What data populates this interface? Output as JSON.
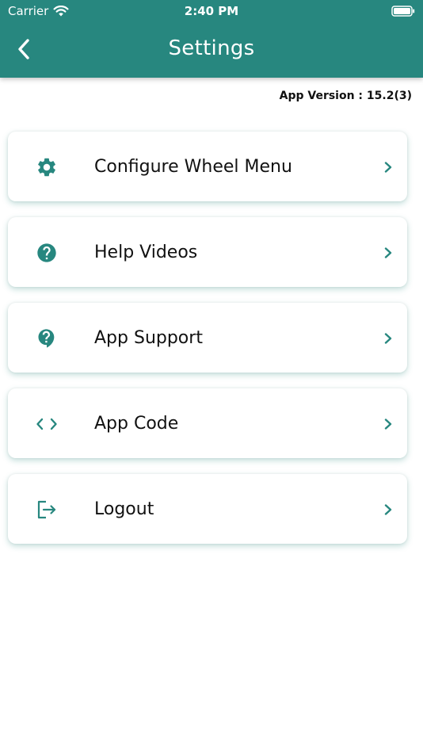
{
  "status_bar": {
    "carrier": "Carrier",
    "time": "2:40 PM"
  },
  "header": {
    "title": "Settings",
    "back_icon": "chevron-left-icon"
  },
  "app_version": "App Version : 15.2(3)",
  "menu": {
    "items": [
      {
        "label": "Configure Wheel Menu",
        "icon": "gear-icon"
      },
      {
        "label": "Help Videos",
        "icon": "help-circle-icon"
      },
      {
        "label": "App Support",
        "icon": "help-bubble-icon"
      },
      {
        "label": "App Code",
        "icon": "code-icon"
      },
      {
        "label": "Logout",
        "icon": "logout-icon"
      }
    ]
  },
  "colors": {
    "primary": "#27877f",
    "background": "#ffffff",
    "text": "#111111"
  }
}
